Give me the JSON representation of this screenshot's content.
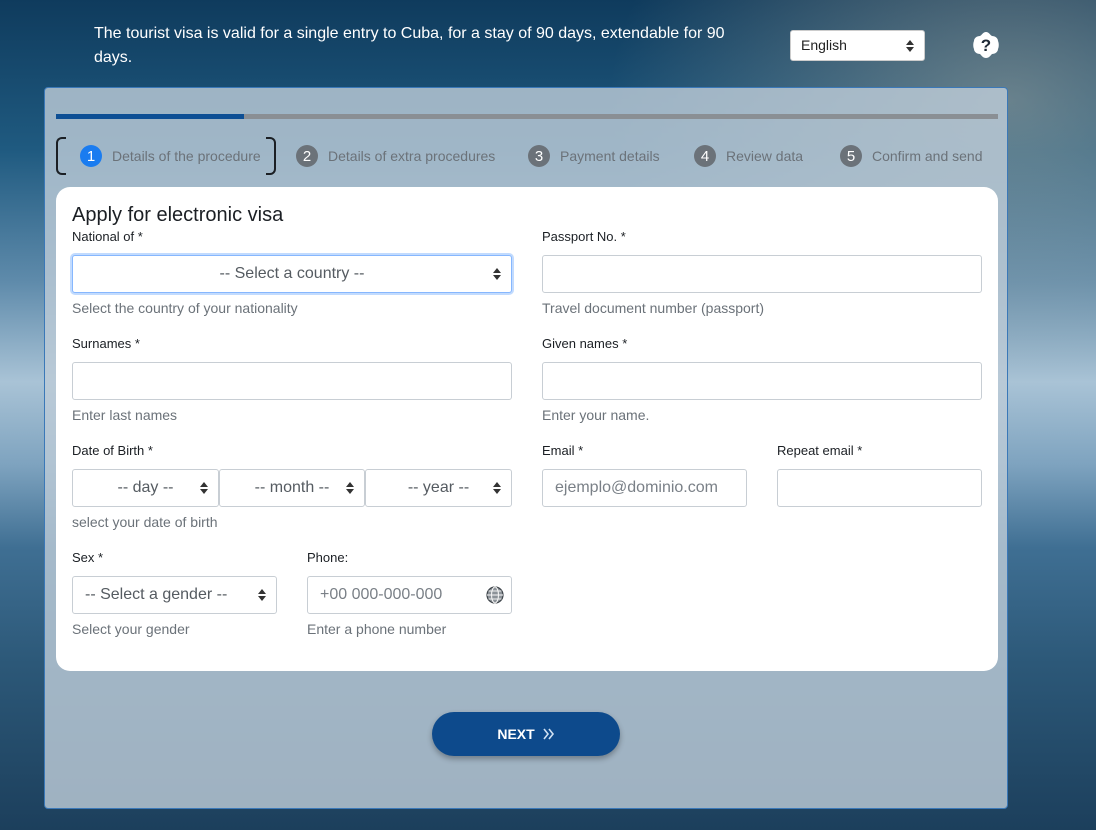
{
  "header": {
    "info_text": "The tourist visa is valid for a single entry to Cuba, for a stay of 90 days, extendable for 90 days.",
    "language": "English"
  },
  "steps": [
    {
      "num": "1",
      "label": "Details of the procedure"
    },
    {
      "num": "2",
      "label": "Details of extra procedures"
    },
    {
      "num": "3",
      "label": "Payment details"
    },
    {
      "num": "4",
      "label": "Review data"
    },
    {
      "num": "5",
      "label": "Confirm and send"
    }
  ],
  "progress": {
    "percent": 20
  },
  "form": {
    "title": "Apply for electronic visa",
    "national_of": {
      "label": "National of *",
      "value": "-- Select a country --",
      "hint": "Select the country of your nationality"
    },
    "passport": {
      "label": "Passport No. *",
      "value": "",
      "hint": "Travel document number (passport)"
    },
    "surnames": {
      "label": "Surnames *",
      "value": "",
      "hint": "Enter last names"
    },
    "given_names": {
      "label": "Given names *",
      "value": "",
      "hint": "Enter your name."
    },
    "dob": {
      "label": "Date of Birth *",
      "day": "-- day --",
      "month": "-- month --",
      "year": "-- year --",
      "hint": "select your date of birth"
    },
    "email": {
      "label": "Email *",
      "placeholder": "ejemplo@dominio.com"
    },
    "repeat_email": {
      "label": "Repeat email *",
      "value": ""
    },
    "sex": {
      "label": "Sex *",
      "value": "-- Select a gender --",
      "hint": "Select your gender"
    },
    "phone": {
      "label": "Phone:",
      "placeholder": "+00 000-000-000",
      "hint": "Enter a phone number"
    }
  },
  "actions": {
    "next_label": "NEXT"
  },
  "colors": {
    "accent": "#0d4a8c",
    "active_step": "#1a7cf0"
  }
}
